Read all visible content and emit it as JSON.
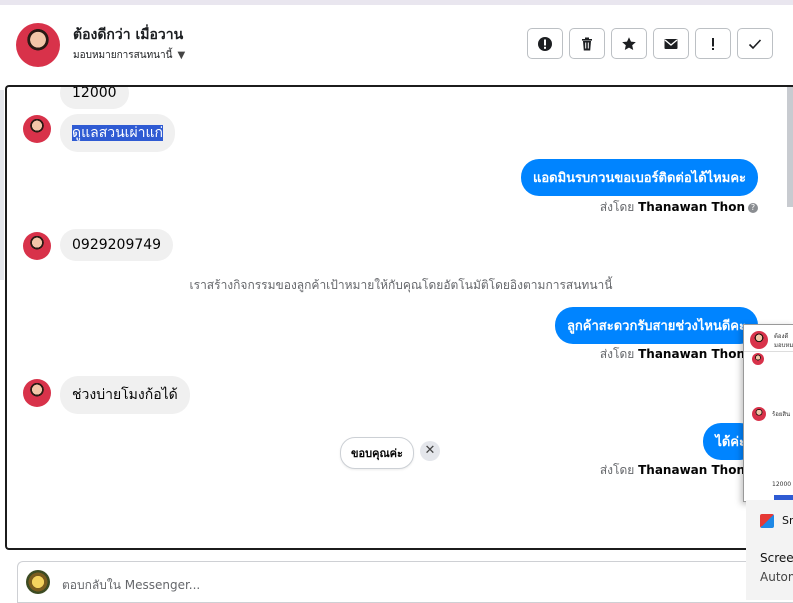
{
  "header": {
    "name": "ต้องดีกว่า เมื่อวาน",
    "assign_label": "มอบหมายการสนทนานี้",
    "actions": [
      {
        "name": "spam-icon",
        "label": "spam"
      },
      {
        "name": "trash-icon",
        "label": "delete"
      },
      {
        "name": "star-icon",
        "label": "star"
      },
      {
        "name": "envelope-icon",
        "label": "mark unread"
      },
      {
        "name": "exclamation-icon",
        "label": "follow up"
      },
      {
        "name": "checkmark-icon",
        "label": "done"
      }
    ]
  },
  "messages": {
    "m1": "12000",
    "m2": "ดูแลสวนเผ่าแก่",
    "m3": "แอดมินรบกวนขอเบอร์ติดต่อได้ไหมคะ",
    "m4": "0929209749",
    "m5": "ลูกค้าสะดวกรับสายช่วงไหนดีคะ",
    "m6": "ช่วงบ่ายโมงก้อได้",
    "m7": "ได้ค่ะ"
  },
  "sent_by": {
    "prefix": "ส่งโดย",
    "agent": "Thanawan Thon"
  },
  "system_message": "เราสร้างกิจกรรมของลูกค้าเป้าหมายให้กับคุณโดยอัตโนมัติโดยอิงตามการสนทนานี้",
  "quick_reply": {
    "label": "ขอบคุณค่ะ",
    "close": "✕"
  },
  "composer": {
    "placeholder": "ตอบกลับใน Messenger..."
  },
  "popup": {
    "line1": "ต้องดี",
    "line2": "มอบหม",
    "line3": "ร้อยสิน",
    "line4": "12000"
  },
  "taskbar_panel": {
    "app_short": "Sn",
    "line1": "Screen",
    "line2": "Autom"
  },
  "colors": {
    "accent": "#0084ff",
    "incoming_bubble": "#f0f0f0",
    "highlight": "#2f5bd3"
  }
}
